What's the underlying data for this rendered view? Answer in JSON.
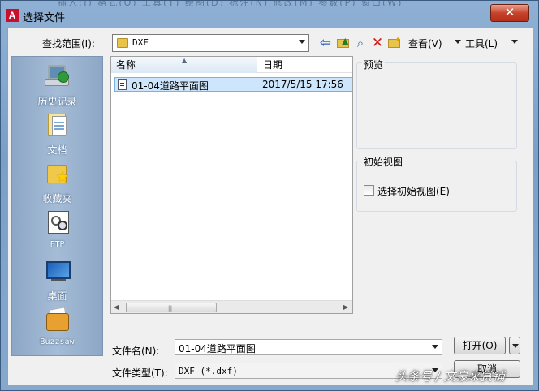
{
  "window": {
    "title": "选择文件",
    "behind_title": "插入(I)  格式(O)  工具(T)  绘图(D)  标注(N)  修改(M)  参数(P)  窗口(W)",
    "close_label": "✕",
    "app_icon_letter": "A"
  },
  "toolbar": {
    "lookin_label": "查找范围(I):",
    "lookin_value": "DXF",
    "view_label": "查看(V)",
    "tools_label": "工具(L)",
    "back_glyph": "⇦",
    "search_glyph": "⌕",
    "delete_glyph": "✕",
    "icons": [
      "back-icon",
      "up-folder-icon",
      "search-web-icon",
      "delete-icon",
      "new-folder-icon"
    ]
  },
  "places": [
    {
      "id": "history",
      "label": "历史记录",
      "icon": "history-icon"
    },
    {
      "id": "documents",
      "label": "文档",
      "icon": "documents-icon"
    },
    {
      "id": "favorites",
      "label": "收藏夹",
      "icon": "favorites-icon"
    },
    {
      "id": "ftp",
      "label": "FTP",
      "icon": "ftp-icon"
    },
    {
      "id": "desktop",
      "label": "桌面",
      "icon": "desktop-icon"
    },
    {
      "id": "buzzsaw",
      "label": "Buzzsaw",
      "icon": "buzzsaw-icon"
    }
  ],
  "filelist": {
    "columns": [
      "名称",
      "日期"
    ],
    "files": [
      {
        "name": "01-04道路平面图",
        "date": "2017/5/15 17:56",
        "selected": true
      }
    ],
    "scroll_grip": "|||"
  },
  "preview": {
    "title": "预览"
  },
  "initial_view": {
    "title": "初始视图",
    "checkbox_label": "选择初始视图(E)",
    "checked": false
  },
  "bottom": {
    "filename_label": "文件名(N):",
    "filename_value": "01-04道路平面图",
    "filetype_label": "文件类型(T):",
    "filetype_value": "DXF (*.dxf)",
    "open_label": "打开(O)",
    "cancel_label": "取消"
  },
  "watermark": "头条号 / 文豪来赏铺"
}
